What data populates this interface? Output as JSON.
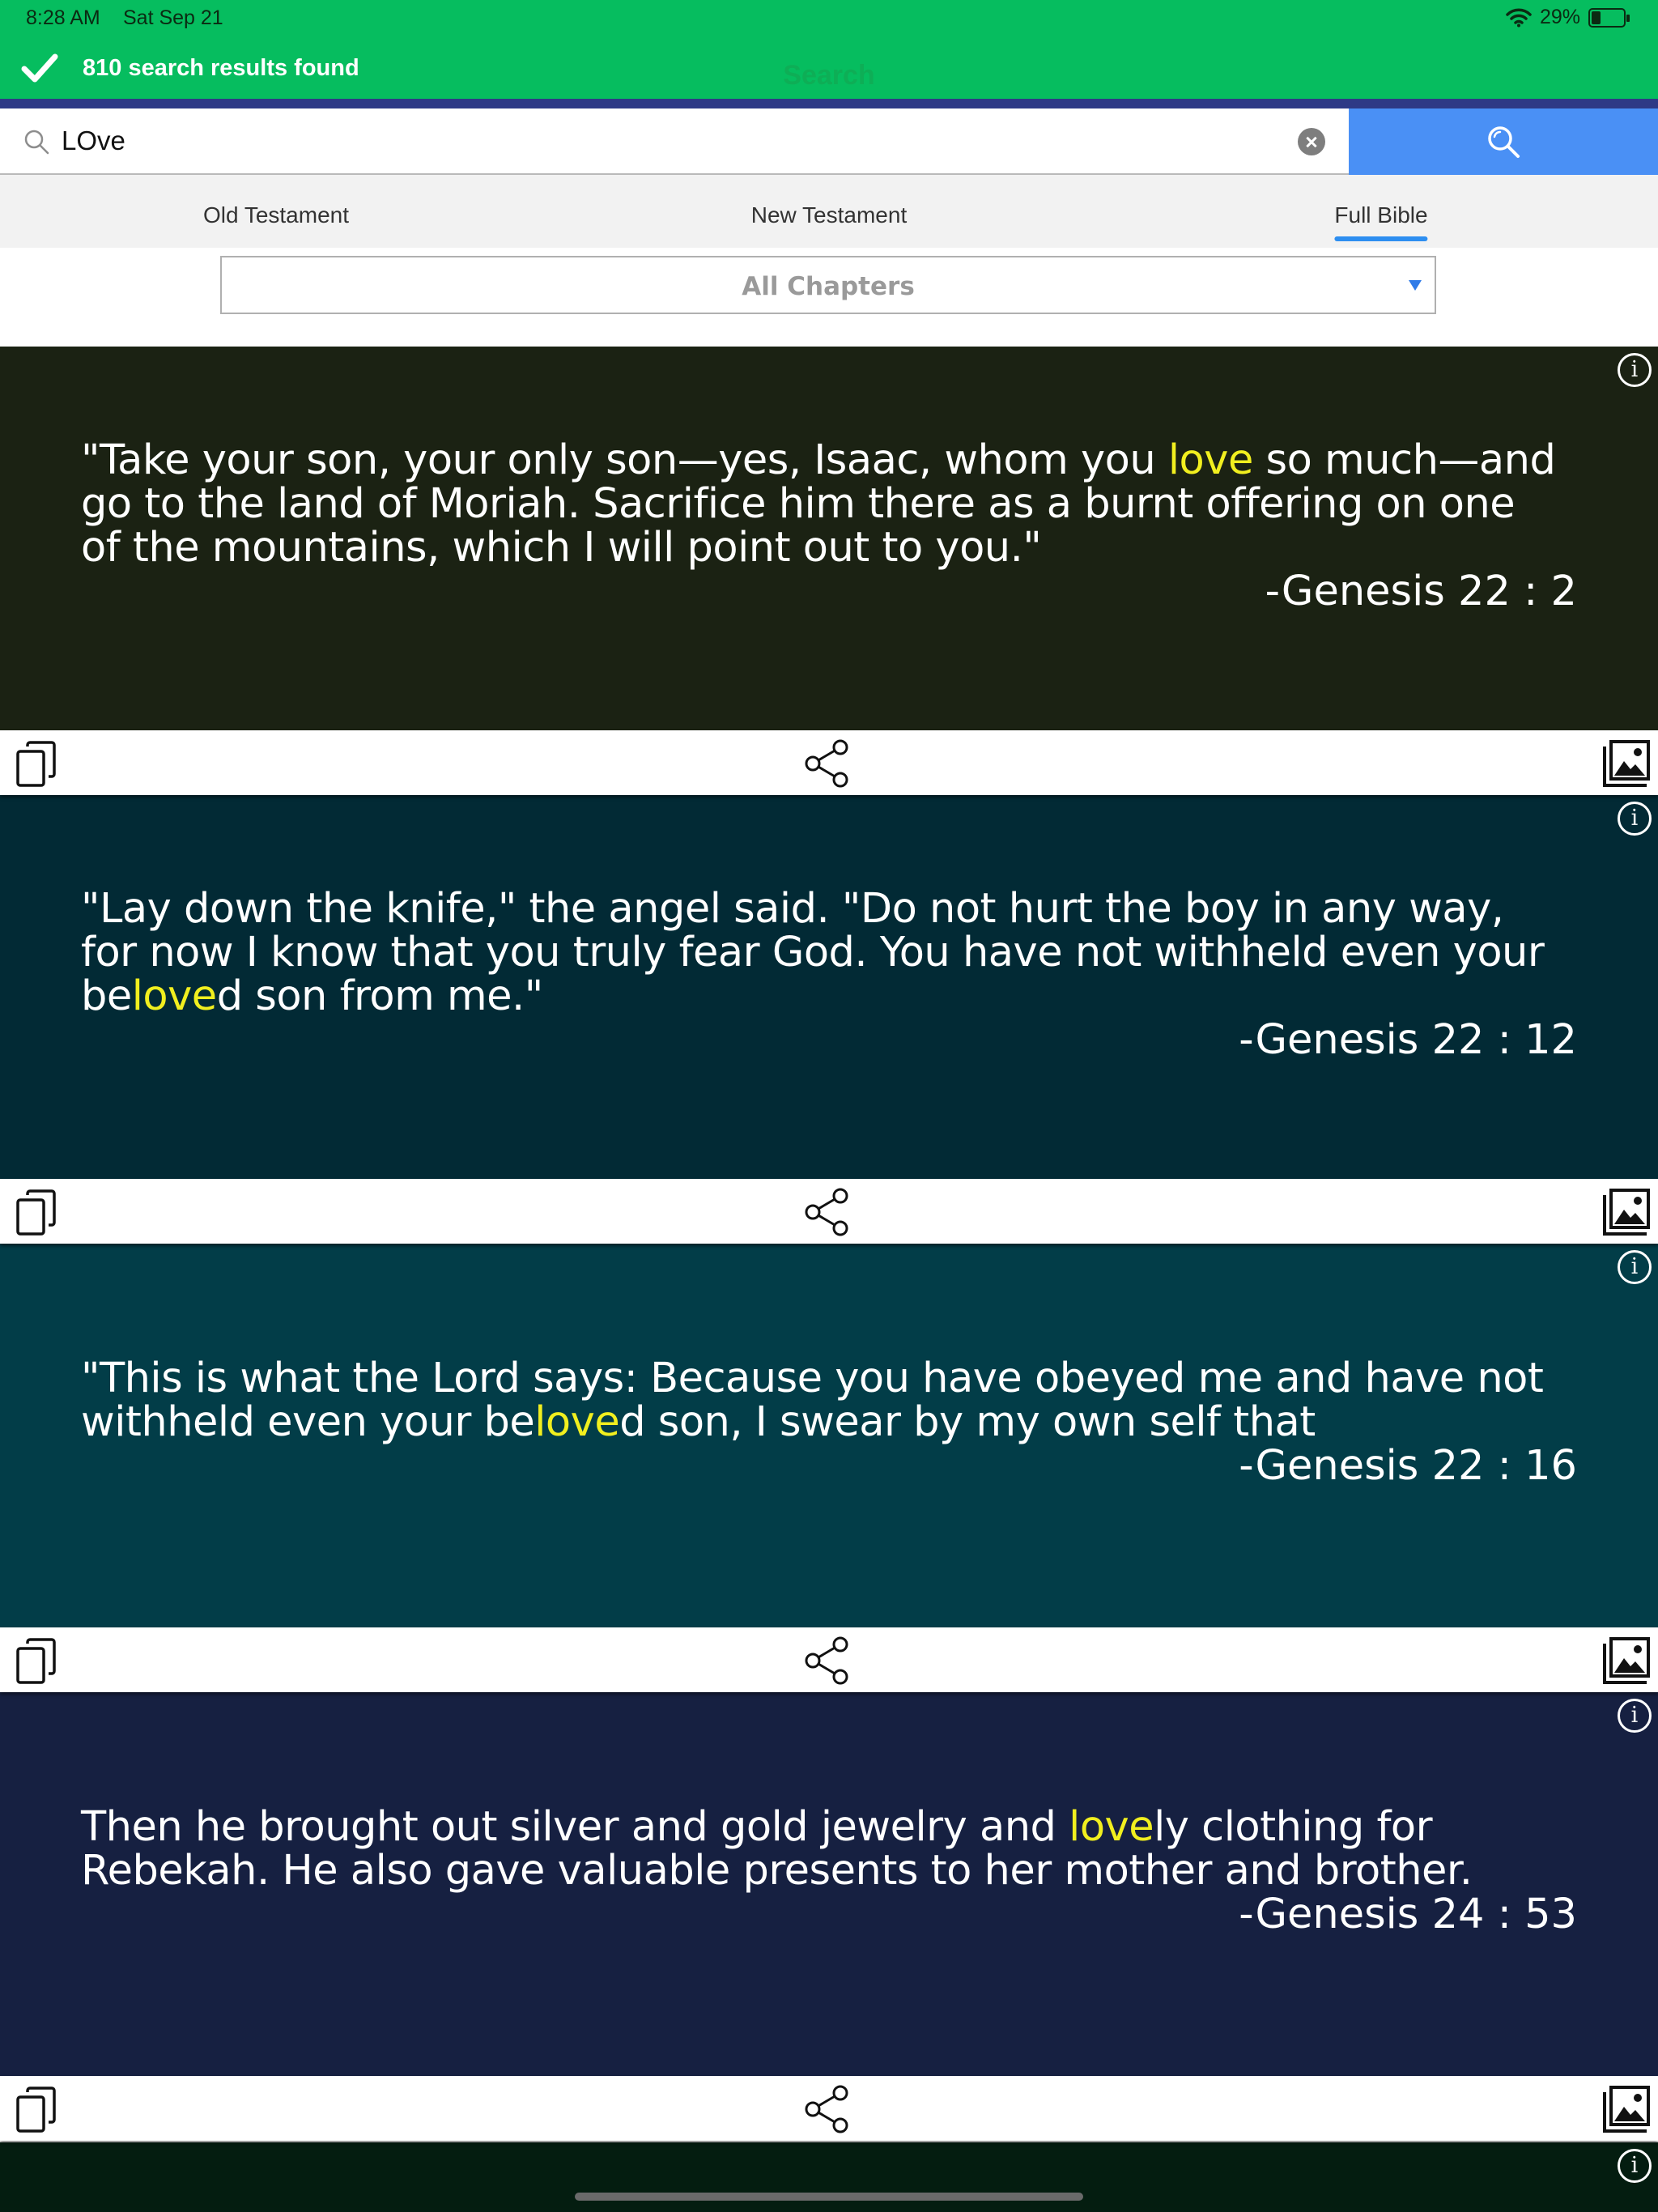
{
  "status_bar": {
    "time": "8:28 AM",
    "date": "Sat Sep 21",
    "battery": "29%",
    "battery_level": 0.29
  },
  "toast": {
    "message": "810 search results found",
    "ghost_title": "Search"
  },
  "search": {
    "query": "LOve",
    "placeholder": ""
  },
  "tabs": [
    {
      "label": "Old Testament"
    },
    {
      "label": "New Testament"
    },
    {
      "label": "Full Bible",
      "active": true
    }
  ],
  "dropdown": {
    "selected": "All Chapters"
  },
  "info_glyph": "i",
  "colors": {
    "toast_green": "#06bd5f",
    "search_button": "#4a90f5",
    "highlight": "#f1ef1f",
    "card_1": "#1b2213",
    "card_2": "#022a35",
    "card_3": "#023d48",
    "card_4": "#162041",
    "bottom_strip": "#041d10"
  },
  "results": [
    {
      "text_before": " \"Take your son, your only son—yes, Isaac, whom you ",
      "highlight": "love",
      "text_after": " so much—and go to the land of Moriah. Sacrifice him there as a burnt offering on one of the mountains, which I will point out to you.\"",
      "reference": "-Genesis 22 : 2"
    },
    {
      "text_before": " \"Lay down the knife,\" the angel said. \"Do not hurt the boy in any way, for now I know that you truly fear God. You have not withheld even your be",
      "highlight": "love",
      "text_after": "d son from me.\"",
      "reference": "-Genesis 22 : 12"
    },
    {
      "text_before": " \"This is what the Lord says: Because you have obeyed me and have not withheld even your be",
      "highlight": "love",
      "text_after": "d son, I swear by my own self that",
      "reference": "-Genesis 22 : 16"
    },
    {
      "text_before": " Then he brought out silver and gold jewelry and ",
      "highlight": "love",
      "text_after": "ly clothing for Rebekah. He also gave valuable presents to her mother and brother.",
      "reference": "-Genesis 24 : 53"
    }
  ]
}
